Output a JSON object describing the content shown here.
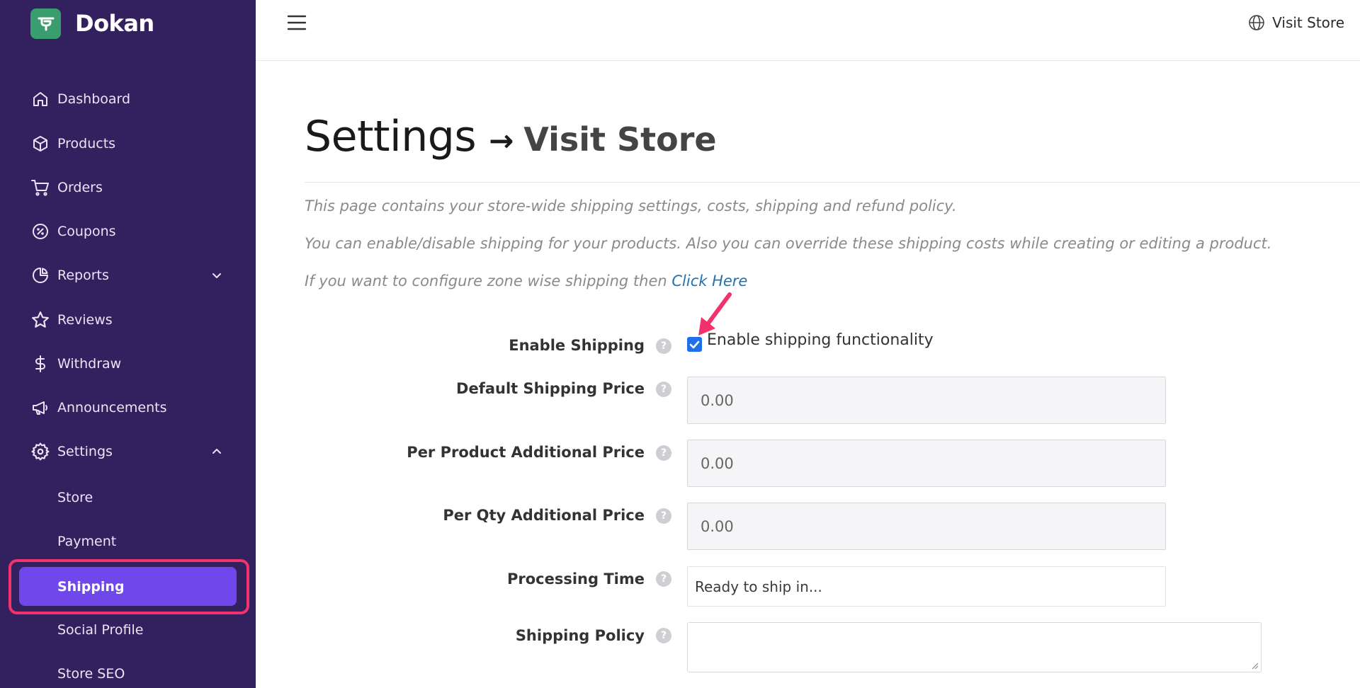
{
  "brand": {
    "name": "Dokan"
  },
  "sidebar": {
    "items": [
      {
        "label": "Dashboard",
        "icon": "home-icon"
      },
      {
        "label": "Products",
        "icon": "box-icon"
      },
      {
        "label": "Orders",
        "icon": "cart-icon"
      },
      {
        "label": "Coupons",
        "icon": "percent-icon"
      },
      {
        "label": "Reports",
        "icon": "pie-chart-icon",
        "chevron": "chevron-down-icon"
      },
      {
        "label": "Reviews",
        "icon": "star-icon"
      },
      {
        "label": "Withdraw",
        "icon": "dollar-icon"
      },
      {
        "label": "Announcements",
        "icon": "megaphone-icon"
      },
      {
        "label": "Settings",
        "icon": "gear-icon",
        "chevron": "chevron-up-icon"
      }
    ],
    "sub_items": [
      {
        "label": "Store"
      },
      {
        "label": "Payment"
      },
      {
        "label": "Shipping",
        "active": true
      },
      {
        "label": "Social Profile"
      },
      {
        "label": "Store SEO"
      }
    ]
  },
  "topbar": {
    "visit_store_label": "Visit Store"
  },
  "page": {
    "title": "Settings",
    "arrow": "→",
    "subtitle": "Visit Store",
    "info_1": "This page contains your store-wide shipping settings, costs, shipping and refund policy.",
    "info_2": "You can enable/disable shipping for your products. Also you can override these shipping costs while creating or editing a product.",
    "info_3_prefix": "If you want to configure zone wise shipping then ",
    "info_3_link": "Click Here"
  },
  "form": {
    "help_glyph": "?",
    "enable_shipping": {
      "label": "Enable Shipping",
      "checkbox_label": "Enable shipping functionality",
      "checked": true
    },
    "default_price": {
      "label": "Default Shipping Price",
      "value": "0.00"
    },
    "per_product": {
      "label": "Per Product Additional Price",
      "value": "0.00"
    },
    "per_qty": {
      "label": "Per Qty Additional Price",
      "value": "0.00"
    },
    "processing_time": {
      "label": "Processing Time",
      "value": "Ready to ship in..."
    },
    "shipping_policy": {
      "label": "Shipping Policy",
      "value": ""
    }
  },
  "colors": {
    "sidebar_bg": "#33205f",
    "active_bg": "#7047eb",
    "highlight": "#f2326a",
    "link": "#2271b1",
    "brand_logo": "#3a9d6f"
  }
}
